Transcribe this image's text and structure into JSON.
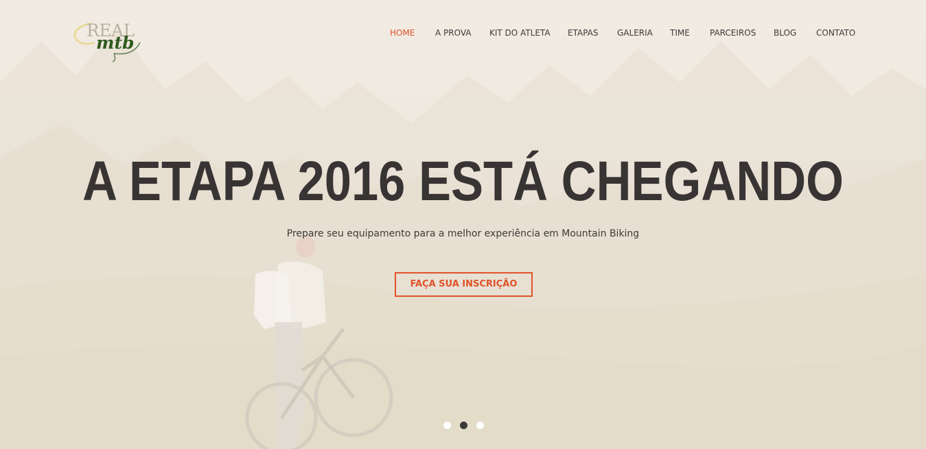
{
  "logo": {
    "line1": "REAL",
    "line2": "mtb"
  },
  "nav": {
    "items": [
      {
        "label": "HOME",
        "active": true
      },
      {
        "label": "A PROVA",
        "active": false
      },
      {
        "label": "KIT DO ATLETA",
        "active": false
      },
      {
        "label": "ETAPAS",
        "active": false
      },
      {
        "label": "GALERIA",
        "active": false
      },
      {
        "label": "TIME",
        "active": false
      },
      {
        "label": "PARCEIROS",
        "active": false
      },
      {
        "label": "BLOG",
        "active": false
      },
      {
        "label": "CONTATO",
        "active": false
      }
    ]
  },
  "hero": {
    "headline": "A ETAPA 2016 ESTÁ CHEGANDO",
    "subline": "Prepare seu equipamento para a melhor experiência em Mountain Biking",
    "cta_label": "FAÇA SUA INSCRIÇÃO",
    "slides": {
      "count": 3,
      "active_index": 1
    }
  },
  "colors": {
    "accent": "#e0522a",
    "text_dark": "#383434",
    "logo_green": "#2e5b1e",
    "dot_active": "#3a3a3a",
    "dot_inactive": "#ffffff"
  }
}
